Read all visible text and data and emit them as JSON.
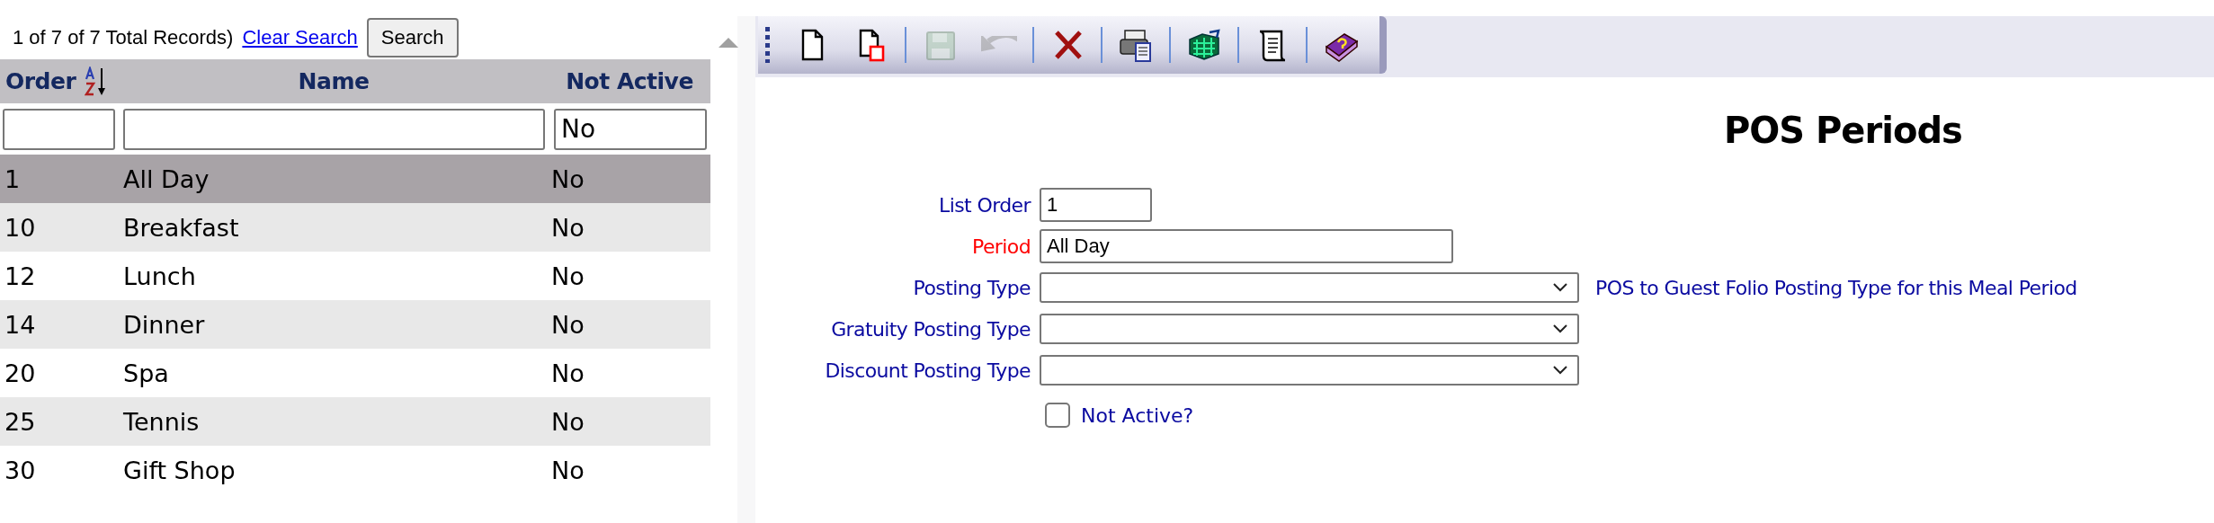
{
  "record_info": "1 of 7 of 7 Total Records)",
  "clear_search": "Clear Search",
  "search_button": "Search",
  "table": {
    "columns": [
      {
        "label": "Order",
        "sorted": true
      },
      {
        "label": "Name",
        "sorted": false
      },
      {
        "label": "Not Active",
        "sorted": false,
        "filter": "No"
      }
    ],
    "rows": [
      {
        "cells": [
          "1",
          "All Day",
          "No"
        ],
        "selected": true
      },
      {
        "cells": [
          "10",
          "Breakfast",
          "No"
        ],
        "selected": false
      },
      {
        "cells": [
          "12",
          "Lunch",
          "No"
        ],
        "selected": false
      },
      {
        "cells": [
          "14",
          "Dinner",
          "No"
        ],
        "selected": false
      },
      {
        "cells": [
          "20",
          "Spa",
          "No"
        ],
        "selected": false
      },
      {
        "cells": [
          "25",
          "Tennis",
          "No"
        ],
        "selected": false
      },
      {
        "cells": [
          "30",
          "Gift Shop",
          "No"
        ],
        "selected": false
      }
    ]
  },
  "toolbar": [
    {
      "kind": "new",
      "disabled": false
    },
    {
      "kind": "copy",
      "disabled": false
    },
    {
      "kind": "save",
      "disabled": true,
      "separator_before": true
    },
    {
      "kind": "undo",
      "disabled": true
    },
    {
      "kind": "delete",
      "disabled": false,
      "separator_before": true
    },
    {
      "kind": "print",
      "disabled": false,
      "separator_before": true
    },
    {
      "kind": "grid",
      "disabled": false,
      "separator_before": true
    },
    {
      "kind": "scroll",
      "disabled": false,
      "separator_before": true
    },
    {
      "kind": "help",
      "disabled": false,
      "separator_before": true
    }
  ],
  "form": {
    "title": "POS Periods",
    "fields": [
      {
        "kind": "number",
        "label": "List Order",
        "value": "1",
        "required": false
      },
      {
        "kind": "text",
        "label": "Period",
        "value": "All Day",
        "required": true
      },
      {
        "kind": "select",
        "label": "Posting Type",
        "required": false,
        "help": "POS to Guest Folio Posting Type for this Meal Period"
      },
      {
        "kind": "select",
        "label": "Gratuity Posting Type",
        "required": false
      },
      {
        "kind": "select",
        "label": "Discount Posting Type",
        "required": false
      },
      {
        "kind": "checkbox",
        "label": "Not Active?",
        "checked": false
      }
    ]
  }
}
